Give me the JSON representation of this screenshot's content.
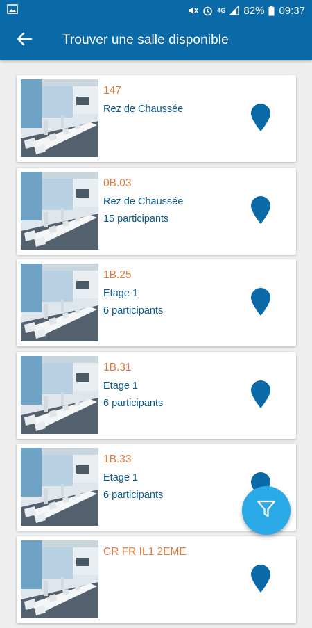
{
  "status_bar": {
    "battery": "82%",
    "time": "09:37",
    "network": "4G"
  },
  "app_bar": {
    "title": "Trouver une salle disponible",
    "back_icon": "arrow-back-icon"
  },
  "rooms": [
    {
      "name": "147",
      "floor": "Rez de Chaussée",
      "capacity": ""
    },
    {
      "name": "0B.03",
      "floor": "Rez de Chaussée",
      "capacity": "15 participants"
    },
    {
      "name": "1B.25",
      "floor": "Etage 1",
      "capacity": "6 participants"
    },
    {
      "name": "1B.31",
      "floor": "Etage 1",
      "capacity": "6 participants"
    },
    {
      "name": "1B.33",
      "floor": "Etage 1",
      "capacity": "6 participants"
    },
    {
      "name": "CR FR IL1 2EME",
      "floor": "",
      "capacity": ""
    }
  ],
  "fab": {
    "icon": "filter-icon"
  },
  "colors": {
    "primary": "#0a6aa8",
    "room_name": "#e07a3a",
    "room_text": "#0a5a8a",
    "pin": "#0a6aa8",
    "fab": "#29a9e6"
  }
}
